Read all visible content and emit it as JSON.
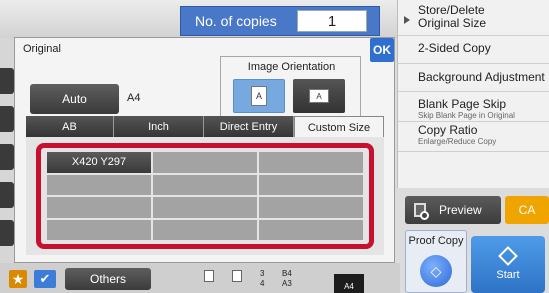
{
  "copies": {
    "label": "No. of copies",
    "value": "1"
  },
  "right_menu": {
    "items": [
      {
        "title": "Store/Delete",
        "title2": "Original Size",
        "subtitle": ""
      },
      {
        "title": "2-Sided Copy",
        "title2": "",
        "subtitle": ""
      },
      {
        "title": "Background Adjustment",
        "title2": "",
        "subtitle": ""
      },
      {
        "title": "Blank Page Skip",
        "title2": "",
        "subtitle": "Skip Blank Page in Original"
      },
      {
        "title": "Copy Ratio",
        "title2": "",
        "subtitle": "Enlarge/Reduce Copy"
      }
    ]
  },
  "preview": {
    "label": "Preview"
  },
  "ca": {
    "label": "CA"
  },
  "proof_copy": {
    "label": "Proof Copy"
  },
  "start": {
    "label": "Start"
  },
  "bottom": {
    "others_label": "Others",
    "trays": [
      {
        "num": "3",
        "size": "B4"
      },
      {
        "num": "4",
        "size": "A3"
      }
    ],
    "paper_size": "A4"
  },
  "dialog": {
    "title": "Original",
    "ok_label": "OK",
    "orientation": {
      "label": "Image Orientation",
      "portrait_glyph": "A",
      "landscape_glyph": "A",
      "selected": "portrait"
    },
    "auto_label": "Auto",
    "auto_size": "A4",
    "tabs": [
      {
        "label": "AB",
        "active": false
      },
      {
        "label": "Inch",
        "active": false
      },
      {
        "label": "Direct Entry",
        "active": false
      },
      {
        "label": "Custom Size",
        "active": true
      }
    ],
    "custom_sizes": [
      "X420 Y297",
      "",
      "",
      "",
      "",
      "",
      "",
      "",
      "",
      "",
      "",
      ""
    ]
  },
  "colors": {
    "accent_blue": "#2f6fd0",
    "selection_red": "#c8102e",
    "ca_orange": "#f0a400"
  }
}
